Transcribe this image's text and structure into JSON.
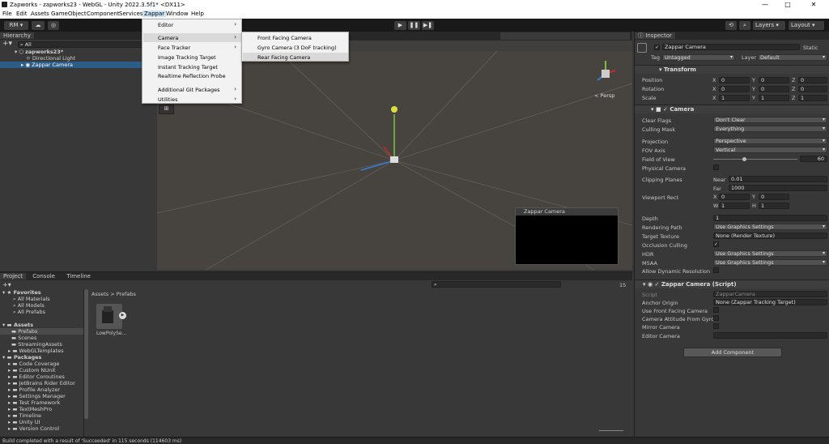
{
  "window": {
    "title": "Zapworks - zapworks23 - WebGL - Unity 2022.3.5f1* <DX11>",
    "min": "—",
    "max": "□",
    "close": "✕"
  },
  "menubar": [
    "File",
    "Edit",
    "Assets",
    "GameObject",
    "Component",
    "Services",
    "Zappar",
    "Window",
    "Help"
  ],
  "toolbar": {
    "account": "RM",
    "layers": "Layers",
    "layout": "Layout",
    "play": "▶",
    "pause": "❚❚",
    "step": "▶❚"
  },
  "hierarchy": {
    "tab": "Hierarchy",
    "search": "All",
    "scene": "zapworks23*",
    "items": [
      "Directional Light",
      "Zappar Camera"
    ]
  },
  "zappar_menu": {
    "items": [
      "Editor",
      "Camera",
      "Face Tracker",
      "Image Tracking Target",
      "Instant Tracking Target",
      "Realtime Reflection Probe",
      "Additional Git Packages",
      "Utilities"
    ]
  },
  "camera_submenu": {
    "items": [
      "Front Facing Camera",
      "Gyro Camera (3 DoF tracking)",
      "Rear Facing Camera"
    ]
  },
  "scene": {
    "persp": "< Persp",
    "preview_title": "Zappar Camera",
    "play_label": "2D"
  },
  "inspector": {
    "tab": "Inspector",
    "object_name": "Zappar Camera",
    "static": "Static",
    "tag_label": "Tag",
    "tag": "Untagged",
    "layer_label": "Layer",
    "layer": "Default",
    "transform": {
      "title": "Transform",
      "rows": [
        {
          "label": "Position",
          "x": "0",
          "y": "0",
          "z": "0"
        },
        {
          "label": "Rotation",
          "x": "0",
          "y": "0",
          "z": "0"
        },
        {
          "label": "Scale",
          "x": "1",
          "y": "1",
          "z": "1"
        }
      ]
    },
    "camera": {
      "title": "Camera",
      "clear_flags_label": "Clear Flags",
      "clear_flags": "Don't Clear",
      "culling_mask_label": "Culling Mask",
      "culling_mask": "Everything",
      "projection_label": "Projection",
      "projection": "Perspective",
      "fov_axis_label": "FOV Axis",
      "fov_axis": "Vertical",
      "fov_label": "Field of View",
      "fov": "60",
      "physical_label": "Physical Camera",
      "clipping_label": "Clipping Planes",
      "near_label": "Near",
      "near": "0.01",
      "far_label": "Far",
      "far": "1000",
      "viewport_label": "Viewport Rect",
      "vx": "0",
      "vy": "0",
      "vw": "1",
      "vh": "1",
      "depth_label": "Depth",
      "depth": "1",
      "rendering_path_label": "Rendering Path",
      "rendering_path": "Use Graphics Settings",
      "target_texture_label": "Target Texture",
      "target_texture": "None (Render Texture)",
      "occlusion_label": "Occlusion Culling",
      "hdr_label": "HDR",
      "hdr": "Use Graphics Settings",
      "msaa_label": "MSAA",
      "msaa": "Use Graphics Settings",
      "dynres_label": "Allow Dynamic Resolution"
    },
    "zappar_script": {
      "title": "Zappar Camera (Script)",
      "script_label": "Script",
      "script": "ZapparCamera",
      "anchor_label": "Anchor Origin",
      "anchor": "None (Zappar Tracking Target)",
      "front_label": "Use Front Facing Camera",
      "gyro_label": "Camera Attitude From Gyro",
      "mirror_label": "Mirror Camera",
      "editor_label": "Editor Camera"
    },
    "add_component": "Add Component"
  },
  "project": {
    "tabs": [
      "Project",
      "Console",
      "Timeline"
    ],
    "favorites": "Favorites",
    "fav_items": [
      "All Materials",
      "All Models",
      "All Prefabs"
    ],
    "assets": "Assets",
    "asset_items": [
      "Prefabs",
      "Scenes",
      "StreamingAssets",
      "WebGLTemplates"
    ],
    "packages": "Packages",
    "package_items": [
      "Code Coverage",
      "Custom NUnit",
      "Editor Coroutines",
      "JetBrains Rider Editor",
      "Profile Analyzer",
      "Settings Manager",
      "Test Framework",
      "TextMeshPro",
      "Timeline",
      "Unity UI",
      "Version Control"
    ],
    "breadcrumb": "Assets > Prefabs",
    "asset_name": "LowPolySe...",
    "count": "15"
  },
  "status": "Build completed with a result of 'Succeeded' in 115 seconds (114603 ms)"
}
